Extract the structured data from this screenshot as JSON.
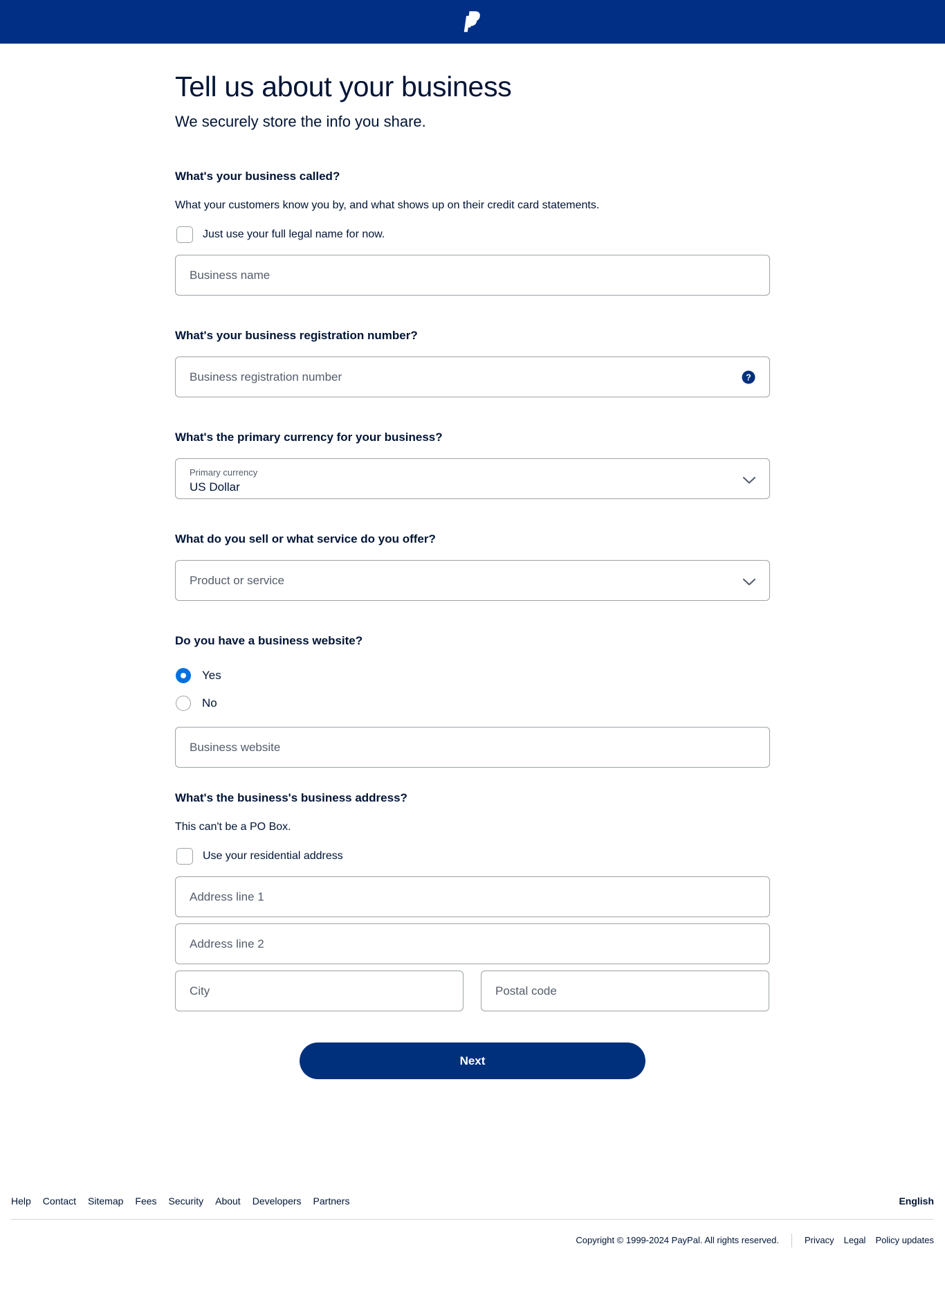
{
  "header": {
    "logo_icon": "paypal-logo-icon",
    "background_color": "#012f86"
  },
  "main": {
    "title": "Tell us about your business",
    "subtitle": "We securely store the info you share.",
    "sections": {
      "business_name": {
        "question": "What's your business called?",
        "helper": "What your customers know you by, and what shows up on their credit card statements.",
        "checkbox_label": "Just use your full legal name for now.",
        "checkbox_checked": false,
        "input_placeholder": "Business name",
        "input_value": ""
      },
      "registration": {
        "question": "What's your business registration number?",
        "input_placeholder": "Business registration number",
        "input_value": "",
        "help_icon": "question-mark-circle-icon"
      },
      "currency": {
        "question": "What's the primary currency for your business?",
        "field_label": "Primary currency",
        "selected_value": "US Dollar",
        "chevron_icon": "chevron-down-icon"
      },
      "product": {
        "question": "What do you sell or what service do you offer?",
        "placeholder": "Product or service",
        "selected_value": "",
        "chevron_icon": "chevron-down-icon"
      },
      "website": {
        "question": "Do you have a business website?",
        "options": [
          {
            "label": "Yes",
            "selected": true
          },
          {
            "label": "No",
            "selected": false
          }
        ],
        "input_placeholder": "Business website",
        "input_value": ""
      },
      "address": {
        "question": "What's the business's business address?",
        "helper": "This can't be a PO Box.",
        "checkbox_label": "Use your residential address",
        "checkbox_checked": false,
        "line1_placeholder": "Address line 1",
        "line2_placeholder": "Address line 2",
        "city_placeholder": "City",
        "postal_placeholder": "Postal code"
      }
    },
    "next_button": "Next"
  },
  "footer": {
    "links": [
      "Help",
      "Contact",
      "Sitemap",
      "Fees",
      "Security",
      "About",
      "Developers",
      "Partners"
    ],
    "language": "English",
    "copyright": "Copyright © 1999-2024 PayPal. All rights reserved.",
    "legal_links": [
      "Privacy",
      "Legal",
      "Policy updates"
    ]
  },
  "colors": {
    "brand_navy": "#012f86",
    "button_navy": "#00307c",
    "accent_blue": "#0070e0",
    "text": "#001435",
    "muted": "#545d6b",
    "border": "#9da3a6"
  }
}
